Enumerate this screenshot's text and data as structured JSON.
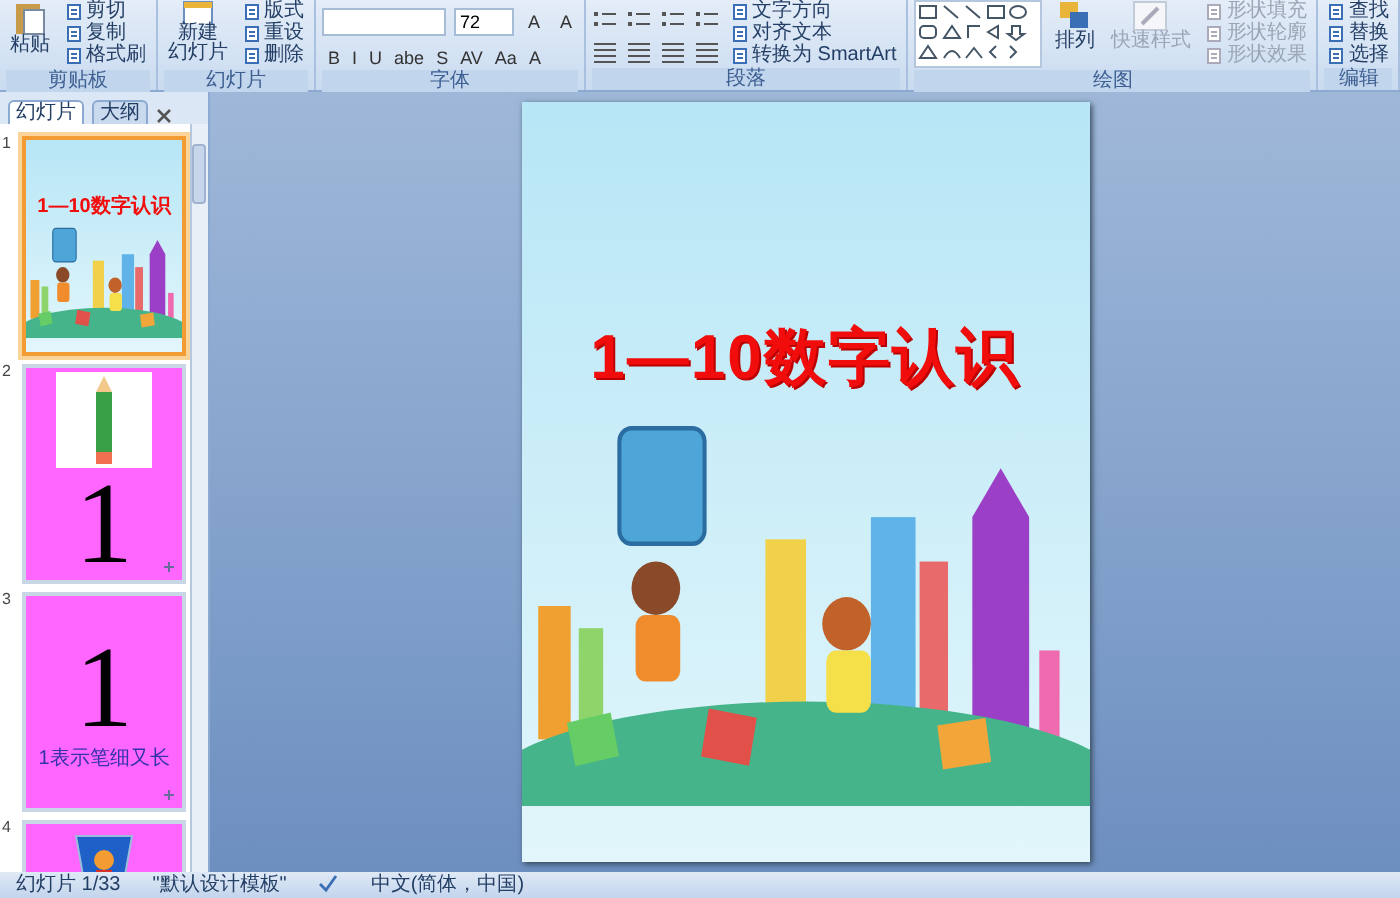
{
  "ribbon": {
    "groups": [
      {
        "kind": "clipboard",
        "label": "剪贴板",
        "paste": "粘贴",
        "actions": [
          {
            "text": "剪切",
            "disabled": false
          },
          {
            "text": "复制",
            "disabled": false
          },
          {
            "text": "格式刷",
            "disabled": false
          }
        ]
      },
      {
        "kind": "slides",
        "label": "幻灯片",
        "new_slide": [
          "新建",
          "幻灯片"
        ],
        "actions": [
          {
            "text": "版式",
            "disabled": false
          },
          {
            "text": "重设",
            "disabled": false
          },
          {
            "text": "删除",
            "disabled": false
          }
        ]
      },
      {
        "kind": "font",
        "label": "字体",
        "font_size": "72",
        "size_buttons": [
          "A",
          "A"
        ],
        "format_buttons": [
          "B",
          "I",
          "U",
          "abe",
          "S",
          "AV",
          "Aa",
          "A"
        ]
      },
      {
        "kind": "paragraph",
        "label": "段落",
        "actions": [
          {
            "text": "文字方向",
            "disabled": false
          },
          {
            "text": "对齐文本",
            "disabled": false
          },
          {
            "text": "转换为 SmartArt",
            "disabled": false
          }
        ]
      },
      {
        "kind": "drawing",
        "label": "绘图",
        "arrange": "排列",
        "quick_styles": {
          "text": "快速样式",
          "disabled": true
        },
        "actions": [
          {
            "text": "形状填充",
            "disabled": true
          },
          {
            "text": "形状轮廓",
            "disabled": true
          },
          {
            "text": "形状效果",
            "disabled": true
          }
        ]
      },
      {
        "kind": "editing",
        "label": "编辑",
        "actions": [
          {
            "text": "查找",
            "disabled": false
          },
          {
            "text": "替换",
            "disabled": false
          },
          {
            "text": "选择",
            "disabled": false
          }
        ]
      }
    ]
  },
  "left_panel": {
    "tabs": [
      {
        "label": "幻灯片",
        "selected": true
      },
      {
        "label": "大纲",
        "selected": false
      }
    ],
    "slides": [
      {
        "number": "1",
        "kind": "title",
        "selected": true,
        "animated": false,
        "title": "1—10数字认识"
      },
      {
        "number": "2",
        "kind": "pencil",
        "selected": false,
        "animated": true,
        "numeral": "1"
      },
      {
        "number": "3",
        "kind": "numeral",
        "selected": false,
        "animated": true,
        "numeral": "1",
        "caption": "1表示笔细又长"
      },
      {
        "number": "4",
        "kind": "picture",
        "selected": false,
        "animated": false
      }
    ]
  },
  "slide": {
    "title": "1—10数字认识"
  },
  "status_bar": {
    "slide_count": "幻灯片 1/33",
    "theme": "\"默认设计模板\"",
    "language": "中文(简体，中国)"
  }
}
